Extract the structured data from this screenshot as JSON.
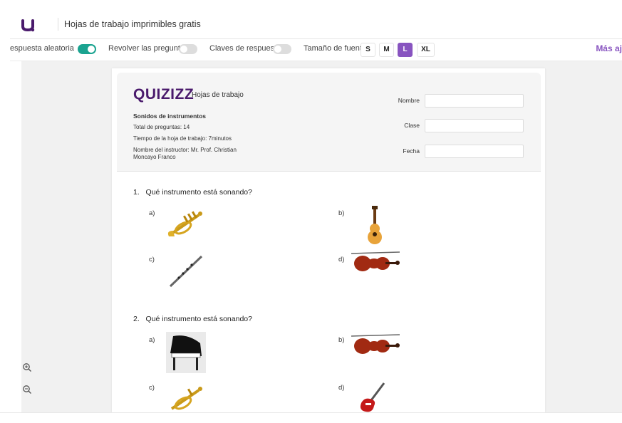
{
  "header": {
    "title": "Hojas de trabajo imprimibles gratis"
  },
  "toolbar": {
    "shuffle_answers_label": "espuesta aleatoria",
    "shuffle_questions_label": "Revolver las preguntas",
    "answer_keys_label": "Claves de respuesta",
    "font_size_label": "Tamaño de fuente",
    "sizes": [
      "S",
      "M",
      "L",
      "XL"
    ],
    "active_size": "L",
    "more_label": "Más aj",
    "accent": "#8854c0",
    "toggle_on_color": "#1aa390"
  },
  "zoom": {
    "in_icon": "zoom-in-icon",
    "out_icon": "zoom-out-icon"
  },
  "worksheet": {
    "brand": "QUIZIZZ",
    "brand_sub": "Hojas de trabajo",
    "quiz_title": "Sonidos de instrumentos",
    "total_questions": "Total de preguntas: 14",
    "time": "Tiempo de la hoja de trabajo: 7minutos",
    "instructor_line1": "Nombre del instructor: Mr. Prof. Christian",
    "instructor_line2": "Moncayo Franco",
    "fields": {
      "name": "Nombre",
      "class": "Clase",
      "date": "Fecha"
    },
    "questions": [
      {
        "number": "1.",
        "text": "Qué instrumento está sonando?",
        "options": [
          {
            "letter": "a)",
            "image": "trumpet"
          },
          {
            "letter": "b)",
            "image": "guitar"
          },
          {
            "letter": "c)",
            "image": "flute"
          },
          {
            "letter": "d)",
            "image": "violin"
          }
        ]
      },
      {
        "number": "2.",
        "text": "Qué instrumento está sonando?",
        "options": [
          {
            "letter": "a)",
            "image": "piano"
          },
          {
            "letter": "b)",
            "image": "violin"
          },
          {
            "letter": "c)",
            "image": "trumpet"
          },
          {
            "letter": "d)",
            "image": "electric-guitar"
          }
        ]
      }
    ]
  }
}
